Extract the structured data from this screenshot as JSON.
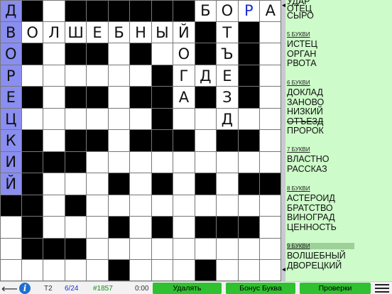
{
  "grid": {
    "rows": [
      "@.#######*****P*",
      "**.#######",
      "..............",
      "..............",
      "..............",
      "..............",
      "..............",
      "..............",
      "..............",
      "..............",
      "..............",
      "..............",
      ".............."
    ],
    "layout": [
      "HW#######LLBLL",
      "HLLLLLLLLL#L#W",
      "H#W##W#L#L#W",
      "H"
    ],
    "cells": [
      [
        "H:Д",
        "B",
        "W",
        "B",
        "B",
        "B",
        "B",
        "B",
        "B",
        "W:Б",
        "W:О",
        "W:Р",
        "W:А"
      ],
      [
        "H:В",
        "W:О",
        "W:Л",
        "W:Ш",
        "W:Е",
        "W:Б",
        "W:Н",
        "W:Ы",
        "W:Й",
        "B",
        "W:Т",
        "B",
        "W"
      ],
      [
        "H:О",
        "B",
        "W",
        "B",
        "B",
        "W",
        "B",
        "W",
        "W:О",
        "B",
        "W:Ъ",
        "B",
        "W"
      ],
      [
        "H:Р",
        "W",
        "W",
        "W",
        "W",
        "W",
        "W",
        "B",
        "W:Г",
        "W:Д",
        "W:Е",
        "B",
        "W"
      ],
      [
        "H:Е",
        "B",
        "W",
        "B",
        "B",
        "W",
        "B",
        "B",
        "W:А",
        "B",
        "W:З",
        "B",
        "W"
      ],
      [
        "H:Ц",
        "W",
        "W",
        "W",
        "W",
        "W",
        "W",
        "B",
        "W",
        "W",
        "W:Д",
        "W",
        "W"
      ],
      [
        "H:К",
        "B",
        "W",
        "B",
        "B",
        "W",
        "B",
        "B",
        "B",
        "W",
        "B",
        "B",
        "W"
      ],
      [
        "H:И",
        "B",
        "B",
        "B",
        "W",
        "W",
        "W",
        "W",
        "W",
        "W",
        "W",
        "W",
        "W"
      ],
      [
        "H:Й",
        "B",
        "W",
        "W",
        "W",
        "B",
        "W",
        "B",
        "W",
        "B",
        "W",
        "B",
        "B"
      ],
      [
        "B",
        "B",
        "W",
        "B",
        "W",
        "W",
        "W",
        "W",
        "W",
        "W",
        "W",
        "W",
        "W"
      ],
      [
        "W",
        "B",
        "W",
        "W",
        "W",
        "B",
        "W",
        "B",
        "W",
        "B",
        "B",
        "B",
        "W"
      ],
      [
        "W",
        "B",
        "B",
        "B",
        "W",
        "W",
        "W",
        "W",
        "W",
        "W",
        "W",
        "W",
        "W"
      ],
      [
        "W",
        "W",
        "W",
        "W",
        "W",
        "B",
        "W",
        "W",
        "W",
        "B",
        "W",
        "W",
        "W"
      ]
    ],
    "blue_cells": [
      "0,11"
    ]
  },
  "panel": {
    "top_partial": [
      "УДАР",
      "ОТЕЦ",
      "СЫРО"
    ],
    "groups": [
      {
        "title": "5 БУКВИ",
        "words": [
          "ИСТЕЦ",
          "ОРГАН",
          "РВОТА"
        ],
        "done": []
      },
      {
        "title": "6 БУКВИ",
        "words": [
          "ДОКЛАД",
          "ЗАНОВО",
          "НИЗКИЙ",
          "ОТЪЕЗД",
          "ПРОРОК"
        ],
        "done": [
          3
        ]
      },
      {
        "title": "7 БУКВИ",
        "words": [
          "ВЛАСТНО",
          "РАССКАЗ"
        ],
        "done": []
      },
      {
        "title": "8 БУКВИ",
        "words": [
          "АСТЕРОИД",
          "БРАТСТВО",
          "ВИНОГРАД",
          "ЦЕННОСТЬ"
        ],
        "done": []
      },
      {
        "title": "9 БУКВИ",
        "words": [
          "ВОЛШЕБНЫЙ",
          "ДВОРЕЦКИЙ"
        ],
        "done": []
      }
    ]
  },
  "bottom": {
    "level": "T2",
    "progress": "6/24",
    "puzzle_number": "#1857",
    "timer": "0:00",
    "delete_label": "Удалять",
    "bonus_label": "Бонус Буква",
    "check_label": "Проверки"
  },
  "colors": {
    "highlight": "#8a8ef0",
    "panel_bg": "#cdfbc9",
    "button_green": "#2fc12f",
    "blue_letter": "#1a2dd8"
  }
}
